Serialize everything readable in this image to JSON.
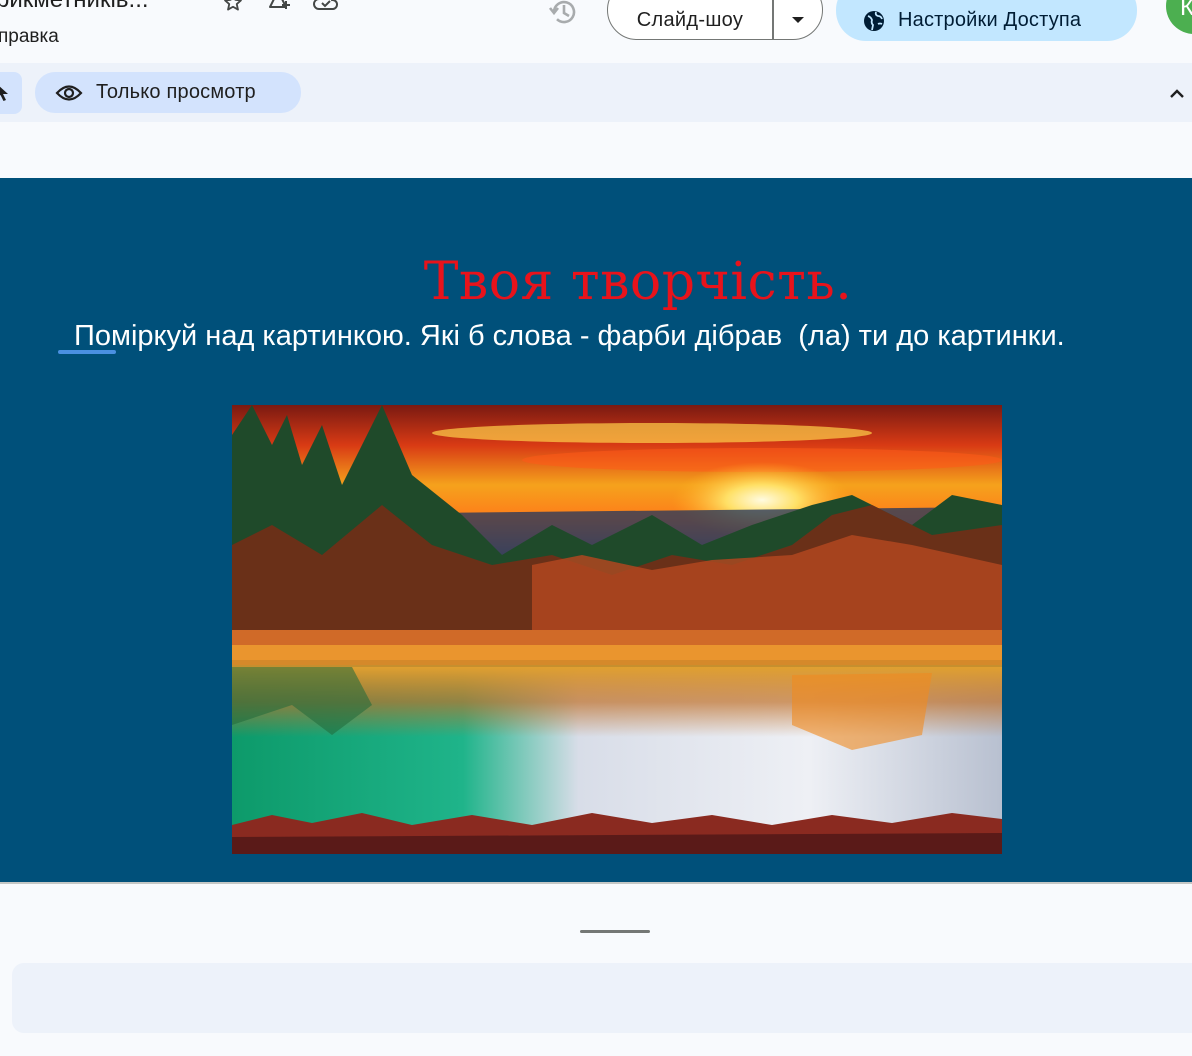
{
  "header": {
    "doc_title": "рикметників...",
    "menu_item": "правка",
    "slideshow_label": "Слайд-шоу",
    "access_label": "Настройки Доступа",
    "avatar_letter": "К"
  },
  "toolbar": {
    "view_only_label": "Только просмотр"
  },
  "slide": {
    "title": "Твоя творчість.",
    "subtitle": " Поміркуй над картинкою. Які б слова - фарби дібрав  (ла) ти до картинки."
  },
  "colors": {
    "slide_background": "#00507a",
    "title_color": "#e8131b",
    "access_button": "#c2e7ff",
    "toolbar_pill": "#d3e3fd",
    "avatar": "#4caf50"
  },
  "icons": {
    "star": "star-icon",
    "add_to_drive": "add-to-drive-icon",
    "cloud_saved": "cloud-saved-icon",
    "history": "history-icon",
    "dropdown": "caret-down-icon",
    "globe": "globe-icon",
    "cursor": "cursor-icon",
    "eye": "eye-icon",
    "collapse": "chevron-up-icon"
  }
}
